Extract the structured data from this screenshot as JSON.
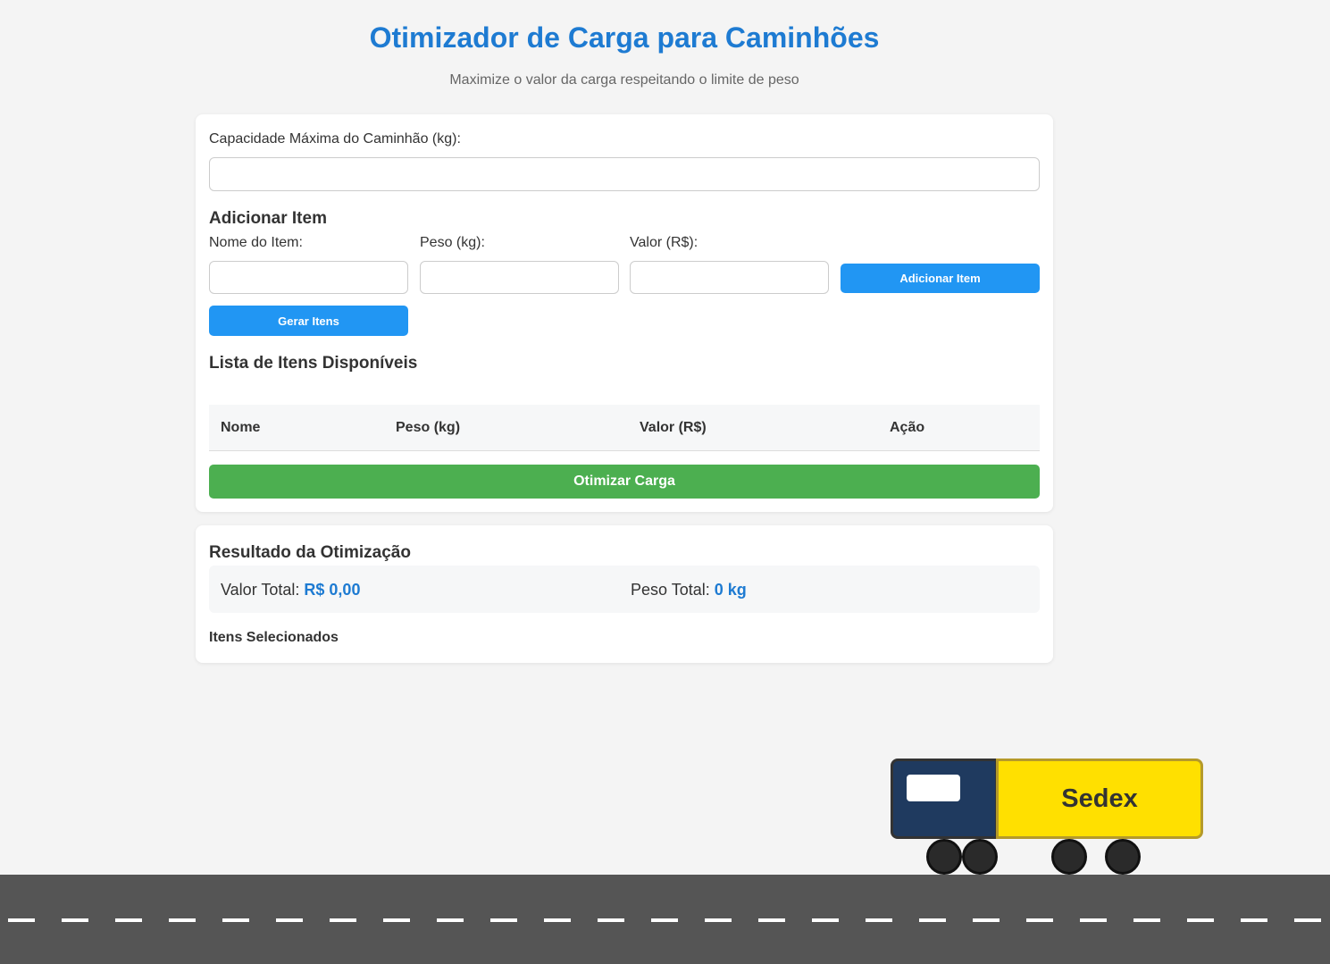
{
  "header": {
    "title": "Otimizador de Carga para Caminhões",
    "subtitle": "Maximize o valor da carga respeitando o limite de peso"
  },
  "capacity": {
    "label": "Capacidade Máxima do Caminhão (kg):",
    "value": ""
  },
  "add_item": {
    "title": "Adicionar Item",
    "name_label": "Nome do Item:",
    "weight_label": "Peso (kg):",
    "value_label": "Valor (R$):",
    "name_value": "",
    "weight_value": "",
    "value_value": "",
    "add_button": "Adicionar Item",
    "generate_button": "Gerar Itens"
  },
  "items_list": {
    "title": "Lista de Itens Disponíveis",
    "columns": [
      "Nome",
      "Peso (kg)",
      "Valor (R$)",
      "Ação"
    ],
    "rows": []
  },
  "optimize_button": "Otimizar Carga",
  "result": {
    "title": "Resultado da Otimização",
    "total_value_label": "Valor Total:",
    "total_value": "R$ 0,00",
    "total_weight_label": "Peso Total:",
    "total_weight": "0 kg",
    "selected_title": "Itens Selecionados"
  },
  "truck": {
    "trailer_label": "Sedex",
    "colors": {
      "cab": "#1f3a5f",
      "trailer": "#ffe000",
      "road": "#555555"
    }
  },
  "colors": {
    "accent": "#1e7bd2",
    "primary_button": "#2196f3",
    "success_button": "#4caf50"
  }
}
